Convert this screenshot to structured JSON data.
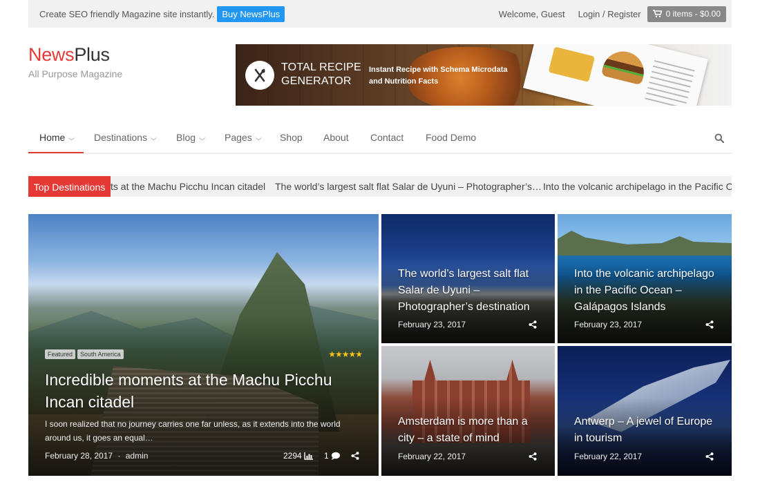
{
  "topbar": {
    "tagline": "Create SEO friendly Magazine site instantly.",
    "buy_label": "Buy NewsPlus",
    "welcome": "Welcome, Guest",
    "login": "Login / Register",
    "cart": "0 items - $0.00"
  },
  "brand": {
    "name_part1": "News",
    "name_part2": "Plus",
    "tagline": "All Purpose Magazine"
  },
  "banner": {
    "title_line1": "TOTAL RECIPE",
    "title_line2": "GENERATOR",
    "subtitle_line1": "Instant Recipe with Schema Microdata",
    "subtitle_line2": "and Nutrition Facts"
  },
  "nav": {
    "items": [
      {
        "label": "Home",
        "dropdown": true
      },
      {
        "label": "Destinations",
        "dropdown": true
      },
      {
        "label": "Blog",
        "dropdown": true
      },
      {
        "label": "Pages",
        "dropdown": true
      },
      {
        "label": "Shop",
        "dropdown": false
      },
      {
        "label": "About",
        "dropdown": false
      },
      {
        "label": "Contact",
        "dropdown": false
      },
      {
        "label": "Food Demo",
        "dropdown": false
      }
    ],
    "active_index": 0,
    "search_icon": "search-icon"
  },
  "ticker": {
    "label": "Top Destinations",
    "items": [
      "ts at the Machu Picchu Incan citadel",
      "The world’s largest salt flat Salar de Uyuni – Photographer’s…",
      "Into the volcanic archipelago in the Pacific Oc"
    ]
  },
  "featured": {
    "tags": [
      "Featured",
      "South America"
    ],
    "rating": "★★★★★",
    "title_line1": "Incredible moments at the Machu Picchu",
    "title_line2": "Incan citadel",
    "excerpt_line1": "I soon realized that no journey carries one far unless, as it extends into the world",
    "excerpt_line2": "around us, it goes an equal…",
    "date": "February 28, 2017",
    "separator": "·",
    "author": "admin",
    "views": "2294",
    "comments": "1"
  },
  "posts": [
    {
      "title_line1": "The world’s largest salt flat",
      "title_line2": "Salar de Uyuni –",
      "title_line3": "Photographer’s destination",
      "date": "February 23, 2017"
    },
    {
      "title_line1": "Into the volcanic archipelago",
      "title_line2": "in the Pacific Ocean –",
      "title_line3": "Galápagos Islands",
      "date": "February 23, 2017"
    },
    {
      "title_line1": "Amsterdam is more than a",
      "title_line2": "city – a state of mind",
      "date": "February 22, 2017"
    },
    {
      "title_line1": "Antwerp – A jewel of Europe",
      "title_line2": "in tourism",
      "date": "February 22, 2017"
    }
  ],
  "colors": {
    "accent": "#e53935",
    "buy_button": "#2196f3",
    "cart": "#888888",
    "stars": "#f9c21b"
  }
}
